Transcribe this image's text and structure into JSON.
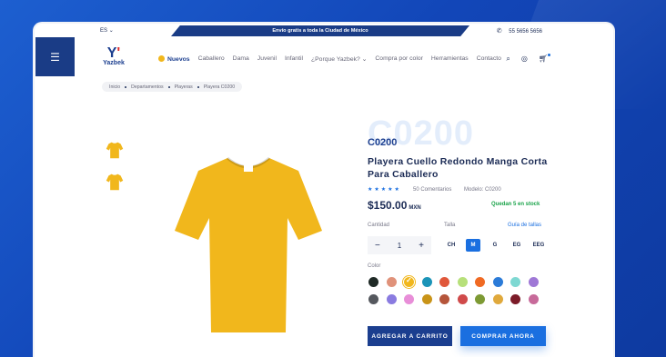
{
  "topbar": {
    "language": "ES",
    "shipping_banner": "Envío gratis a toda la Ciudad de México",
    "phone": "55 5656 5656"
  },
  "brand": {
    "name": "Yazbek"
  },
  "nav": {
    "items": [
      {
        "label": "Nuevos"
      },
      {
        "label": "Caballero"
      },
      {
        "label": "Dama"
      },
      {
        "label": "Juvenil"
      },
      {
        "label": "Infantil"
      },
      {
        "label": "¿Porque Yazbek?"
      },
      {
        "label": "Compra por color"
      },
      {
        "label": "Herramientas"
      },
      {
        "label": "Contacto"
      }
    ]
  },
  "breadcrumb": [
    "Inicio",
    "Departamentos",
    "Playeras",
    "Playera C0200"
  ],
  "product": {
    "ghost_code": "C0200",
    "code": "C0200",
    "title": "Playera Cuello Redondo Manga Corta Para Caballero",
    "rating_stars": "★★★★★",
    "rating": 5,
    "reviews": "50 Comentarios",
    "model": "Modelo: C0200",
    "price": "$150.00",
    "currency": "MXN",
    "stock": "Quedan 5 en stock",
    "qty_label": "Cantidad",
    "quantity": "1",
    "size_label": "Talla",
    "size_guide": "Guía de tallas",
    "sizes": [
      "CH",
      "M",
      "G",
      "EG",
      "EEG"
    ],
    "selected_size": "M",
    "color_label": "Color",
    "colors": [
      "#1f2a26",
      "#e0927a",
      "#f1b71c",
      "#1b94b8",
      "#e0573a",
      "#b7e07a",
      "#f06a23",
      "#2b7bd8",
      "#7ed8d2",
      "#9f78d6",
      "#55585e",
      "#8a7be0",
      "#e88ed8",
      "#c99418",
      "#b5553a",
      "#d04a4a",
      "#7d9a34",
      "#e0a93c",
      "#7b1b28",
      "#c76a9a"
    ],
    "selected_color_index": 2,
    "shirt_color": "#f1b71c",
    "add_to_cart": "AGREGAR A CARRITO",
    "buy_now": "COMPRAR AHORA"
  }
}
